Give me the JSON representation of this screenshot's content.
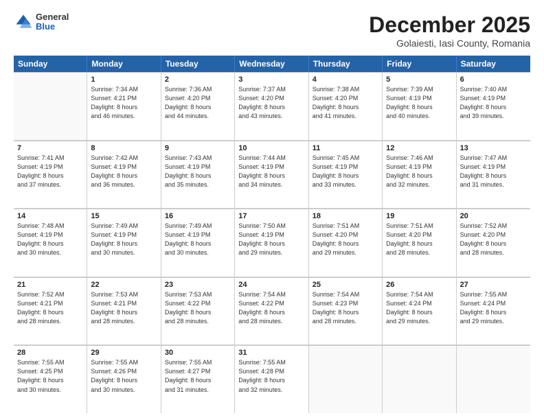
{
  "header": {
    "logo_general": "General",
    "logo_blue": "Blue",
    "month_title": "December 2025",
    "location": "Golaiesti, Iasi County, Romania"
  },
  "days_of_week": [
    "Sunday",
    "Monday",
    "Tuesday",
    "Wednesday",
    "Thursday",
    "Friday",
    "Saturday"
  ],
  "weeks": [
    [
      {
        "day": "",
        "info": ""
      },
      {
        "day": "1",
        "info": "Sunrise: 7:34 AM\nSunset: 4:21 PM\nDaylight: 8 hours\nand 46 minutes."
      },
      {
        "day": "2",
        "info": "Sunrise: 7:36 AM\nSunset: 4:20 PM\nDaylight: 8 hours\nand 44 minutes."
      },
      {
        "day": "3",
        "info": "Sunrise: 7:37 AM\nSunset: 4:20 PM\nDaylight: 8 hours\nand 43 minutes."
      },
      {
        "day": "4",
        "info": "Sunrise: 7:38 AM\nSunset: 4:20 PM\nDaylight: 8 hours\nand 41 minutes."
      },
      {
        "day": "5",
        "info": "Sunrise: 7:39 AM\nSunset: 4:19 PM\nDaylight: 8 hours\nand 40 minutes."
      },
      {
        "day": "6",
        "info": "Sunrise: 7:40 AM\nSunset: 4:19 PM\nDaylight: 8 hours\nand 39 minutes."
      }
    ],
    [
      {
        "day": "7",
        "info": "Sunrise: 7:41 AM\nSunset: 4:19 PM\nDaylight: 8 hours\nand 37 minutes."
      },
      {
        "day": "8",
        "info": "Sunrise: 7:42 AM\nSunset: 4:19 PM\nDaylight: 8 hours\nand 36 minutes."
      },
      {
        "day": "9",
        "info": "Sunrise: 7:43 AM\nSunset: 4:19 PM\nDaylight: 8 hours\nand 35 minutes."
      },
      {
        "day": "10",
        "info": "Sunrise: 7:44 AM\nSunset: 4:19 PM\nDaylight: 8 hours\nand 34 minutes."
      },
      {
        "day": "11",
        "info": "Sunrise: 7:45 AM\nSunset: 4:19 PM\nDaylight: 8 hours\nand 33 minutes."
      },
      {
        "day": "12",
        "info": "Sunrise: 7:46 AM\nSunset: 4:19 PM\nDaylight: 8 hours\nand 32 minutes."
      },
      {
        "day": "13",
        "info": "Sunrise: 7:47 AM\nSunset: 4:19 PM\nDaylight: 8 hours\nand 31 minutes."
      }
    ],
    [
      {
        "day": "14",
        "info": "Sunrise: 7:48 AM\nSunset: 4:19 PM\nDaylight: 8 hours\nand 30 minutes."
      },
      {
        "day": "15",
        "info": "Sunrise: 7:49 AM\nSunset: 4:19 PM\nDaylight: 8 hours\nand 30 minutes."
      },
      {
        "day": "16",
        "info": "Sunrise: 7:49 AM\nSunset: 4:19 PM\nDaylight: 8 hours\nand 30 minutes."
      },
      {
        "day": "17",
        "info": "Sunrise: 7:50 AM\nSunset: 4:19 PM\nDaylight: 8 hours\nand 29 minutes."
      },
      {
        "day": "18",
        "info": "Sunrise: 7:51 AM\nSunset: 4:20 PM\nDaylight: 8 hours\nand 29 minutes."
      },
      {
        "day": "19",
        "info": "Sunrise: 7:51 AM\nSunset: 4:20 PM\nDaylight: 8 hours\nand 28 minutes."
      },
      {
        "day": "20",
        "info": "Sunrise: 7:52 AM\nSunset: 4:20 PM\nDaylight: 8 hours\nand 28 minutes."
      }
    ],
    [
      {
        "day": "21",
        "info": "Sunrise: 7:52 AM\nSunset: 4:21 PM\nDaylight: 8 hours\nand 28 minutes."
      },
      {
        "day": "22",
        "info": "Sunrise: 7:53 AM\nSunset: 4:21 PM\nDaylight: 8 hours\nand 28 minutes."
      },
      {
        "day": "23",
        "info": "Sunrise: 7:53 AM\nSunset: 4:22 PM\nDaylight: 8 hours\nand 28 minutes."
      },
      {
        "day": "24",
        "info": "Sunrise: 7:54 AM\nSunset: 4:22 PM\nDaylight: 8 hours\nand 28 minutes."
      },
      {
        "day": "25",
        "info": "Sunrise: 7:54 AM\nSunset: 4:23 PM\nDaylight: 8 hours\nand 28 minutes."
      },
      {
        "day": "26",
        "info": "Sunrise: 7:54 AM\nSunset: 4:24 PM\nDaylight: 8 hours\nand 29 minutes."
      },
      {
        "day": "27",
        "info": "Sunrise: 7:55 AM\nSunset: 4:24 PM\nDaylight: 8 hours\nand 29 minutes."
      }
    ],
    [
      {
        "day": "28",
        "info": "Sunrise: 7:55 AM\nSunset: 4:25 PM\nDaylight: 8 hours\nand 30 minutes."
      },
      {
        "day": "29",
        "info": "Sunrise: 7:55 AM\nSunset: 4:26 PM\nDaylight: 8 hours\nand 30 minutes."
      },
      {
        "day": "30",
        "info": "Sunrise: 7:55 AM\nSunset: 4:27 PM\nDaylight: 8 hours\nand 31 minutes."
      },
      {
        "day": "31",
        "info": "Sunrise: 7:55 AM\nSunset: 4:28 PM\nDaylight: 8 hours\nand 32 minutes."
      },
      {
        "day": "",
        "info": ""
      },
      {
        "day": "",
        "info": ""
      },
      {
        "day": "",
        "info": ""
      }
    ]
  ]
}
